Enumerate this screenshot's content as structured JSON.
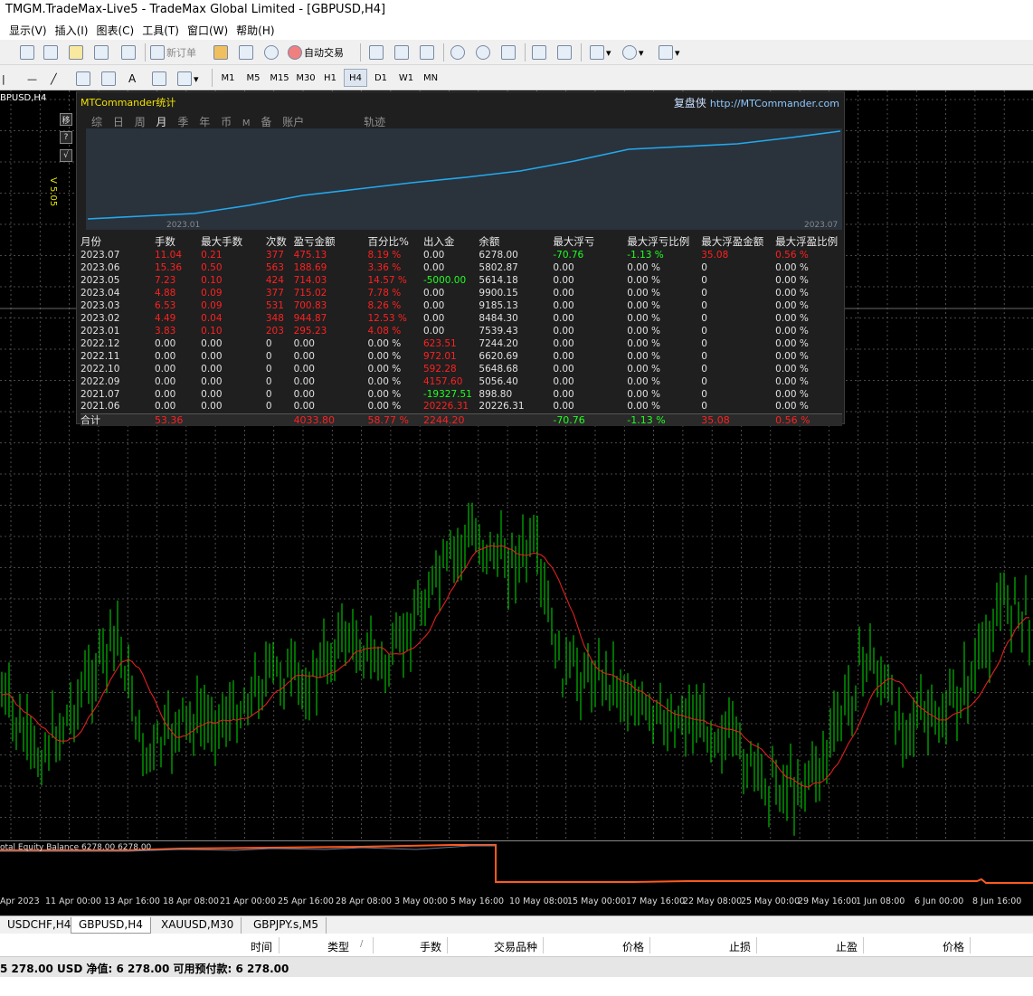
{
  "window": {
    "title": "TMGM.TradeMax-Live5 - TradeMax Global Limited - [GBPUSD,H4]"
  },
  "menu": [
    "显示(V)",
    "插入(I)",
    "图表(C)",
    "工具(T)",
    "窗口(W)",
    "帮助(H)"
  ],
  "toolbar": {
    "new_order": "新订单",
    "auto_trade": "自动交易"
  },
  "timeframes": [
    "M1",
    "M5",
    "M15",
    "M30",
    "H1",
    "H4",
    "D1",
    "W1",
    "MN"
  ],
  "active_timeframe": "H4",
  "chart": {
    "symbol_label": "BPUSD,H4",
    "side_buttons": [
      "移",
      "?",
      "√"
    ],
    "version": "V 5.05",
    "equity_indicator": "otal Equity Balance 6278.00 6278.00",
    "time_labels": [
      "Apr 2023",
      "11 Apr 00:00",
      "13 Apr 16:00",
      "18 Apr 08:00",
      "21 Apr 00:00",
      "25 Apr 16:00",
      "28 Apr 08:00",
      "3 May 00:00",
      "5 May 16:00",
      "10 May 08:00",
      "15 May 00:00",
      "17 May 16:00",
      "22 May 08:00",
      "25 May 00:00",
      "29 May 16:00",
      "1 Jun 08:00",
      "6 Jun 00:00",
      "8 Jun 16:00"
    ]
  },
  "colors": {
    "bull": "#00cc00",
    "ma": "#e02020",
    "equity_curve": "#22aaee",
    "grid": "#606060",
    "balance": "#ff5a1e"
  },
  "panel": {
    "title": "MTCommander统计",
    "brand": "复盘侠",
    "link": "http://MTCommander.com",
    "tabs": [
      "综",
      "日",
      "周",
      "月",
      "季",
      "年",
      "币",
      "M",
      "备",
      "账户",
      "轨迹"
    ],
    "active_tab": "月",
    "curve_start": "2023.01",
    "curve_end": "2023.07",
    "headers": [
      "月份",
      "手数",
      "最大手数",
      "次数",
      "盈亏金额",
      "百分比%",
      "出入金",
      "余额",
      "最大浮亏",
      "最大浮亏比例",
      "最大浮盈金额",
      "最大浮盈比例"
    ],
    "rows": [
      [
        "2023.07",
        "11.04",
        "0.21",
        "377",
        "475.13",
        "8.19 %",
        "0.00",
        "6278.00",
        "-70.76",
        "-1.13 %",
        "35.08",
        "0.56 %"
      ],
      [
        "2023.06",
        "15.36",
        "0.50",
        "563",
        "188.69",
        "3.36 %",
        "0.00",
        "5802.87",
        "0.00",
        "0.00 %",
        "0",
        "0.00 %"
      ],
      [
        "2023.05",
        "7.23",
        "0.10",
        "424",
        "714.03",
        "14.57 %",
        "-5000.00",
        "5614.18",
        "0.00",
        "0.00 %",
        "0",
        "0.00 %"
      ],
      [
        "2023.04",
        "4.88",
        "0.09",
        "377",
        "715.02",
        "7.78 %",
        "0.00",
        "9900.15",
        "0.00",
        "0.00 %",
        "0",
        "0.00 %"
      ],
      [
        "2023.03",
        "6.53",
        "0.09",
        "531",
        "700.83",
        "8.26 %",
        "0.00",
        "9185.13",
        "0.00",
        "0.00 %",
        "0",
        "0.00 %"
      ],
      [
        "2023.02",
        "4.49",
        "0.04",
        "348",
        "944.87",
        "12.53 %",
        "0.00",
        "8484.30",
        "0.00",
        "0.00 %",
        "0",
        "0.00 %"
      ],
      [
        "2023.01",
        "3.83",
        "0.10",
        "203",
        "295.23",
        "4.08 %",
        "0.00",
        "7539.43",
        "0.00",
        "0.00 %",
        "0",
        "0.00 %"
      ],
      [
        "2022.12",
        "0.00",
        "0.00",
        "0",
        "0.00",
        "0.00 %",
        "623.51",
        "7244.20",
        "0.00",
        "0.00 %",
        "0",
        "0.00 %"
      ],
      [
        "2022.11",
        "0.00",
        "0.00",
        "0",
        "0.00",
        "0.00 %",
        "972.01",
        "6620.69",
        "0.00",
        "0.00 %",
        "0",
        "0.00 %"
      ],
      [
        "2022.10",
        "0.00",
        "0.00",
        "0",
        "0.00",
        "0.00 %",
        "592.28",
        "5648.68",
        "0.00",
        "0.00 %",
        "0",
        "0.00 %"
      ],
      [
        "2022.09",
        "0.00",
        "0.00",
        "0",
        "0.00",
        "0.00 %",
        "4157.60",
        "5056.40",
        "0.00",
        "0.00 %",
        "0",
        "0.00 %"
      ],
      [
        "2021.07",
        "0.00",
        "0.00",
        "0",
        "0.00",
        "0.00 %",
        "-19327.51",
        "898.80",
        "0.00",
        "0.00 %",
        "0",
        "0.00 %"
      ],
      [
        "2021.06",
        "0.00",
        "0.00",
        "0",
        "0.00",
        "0.00 %",
        "20226.31",
        "20226.31",
        "0.00",
        "0.00 %",
        "0",
        "0.00 %"
      ]
    ],
    "total": [
      "合计",
      "53.36",
      "",
      "",
      "4033.80",
      "58.77 %",
      "2244.20",
      "",
      "-70.76",
      "-1.13 %",
      "35.08",
      "0.56 %"
    ]
  },
  "chart_tabs": [
    "USDCHF,H4",
    "GBPUSD,H4",
    "XAUUSD,M30",
    "GBPJPY.s,M5"
  ],
  "active_chart_tab": "GBPUSD,H4",
  "terminal": {
    "headers": [
      "时间",
      "类型",
      "手数",
      "交易品种",
      "价格",
      "止损",
      "止盈",
      "价格"
    ]
  },
  "status": {
    "text": "5 278.00 USD  净值: 6 278.00  可用预付款: 6 278.00"
  }
}
